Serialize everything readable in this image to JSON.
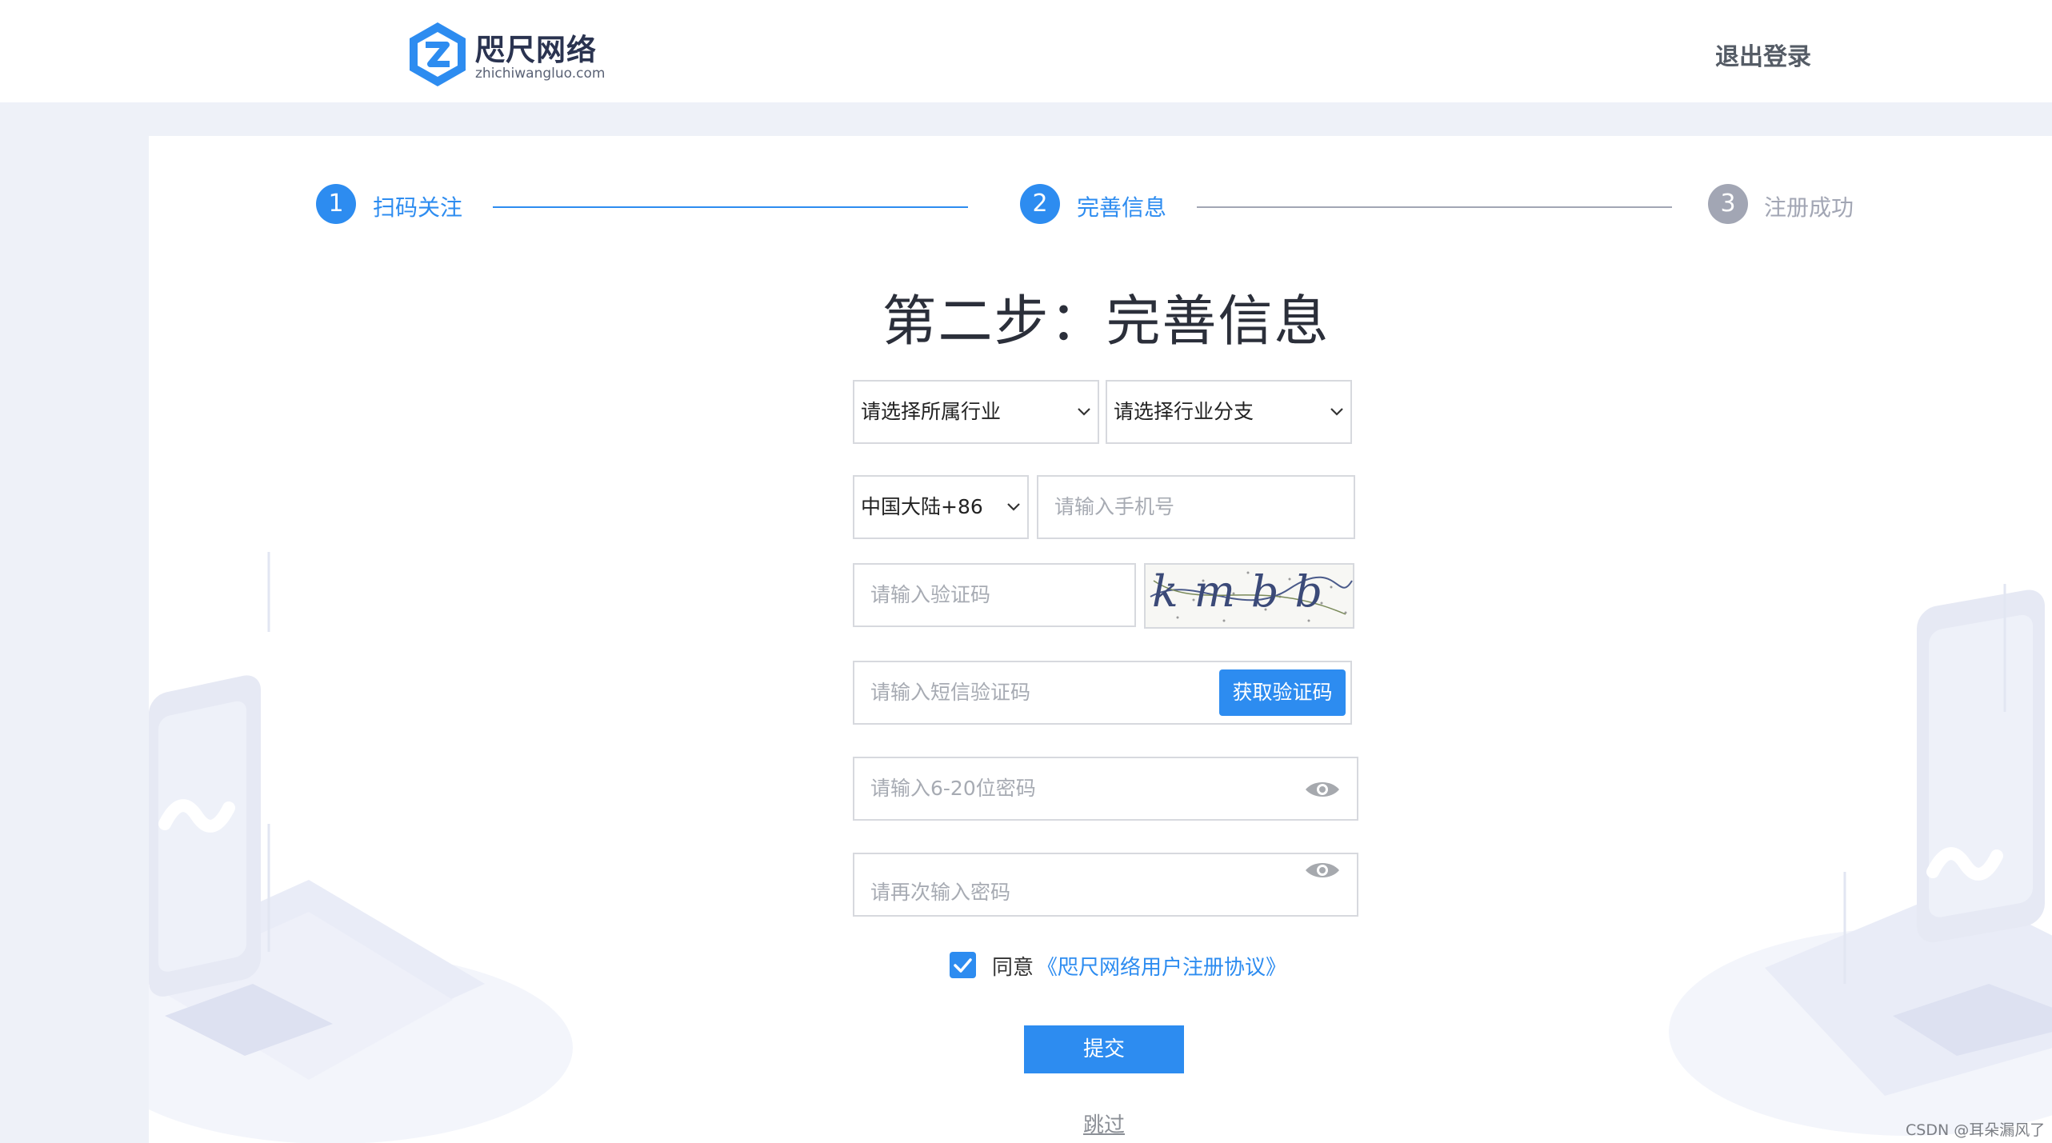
{
  "header": {
    "logo_name": "咫尺网络",
    "logo_sub": "zhichiwangluo.com",
    "logout_label": "退出登录"
  },
  "steps": [
    {
      "number": "1",
      "label": "扫码关注"
    },
    {
      "number": "2",
      "label": "完善信息"
    },
    {
      "number": "3",
      "label": "注册成功"
    }
  ],
  "colors": {
    "accent": "#2d8cf0",
    "inactive": "#a2a6b4",
    "background": "#eef1f8"
  },
  "form": {
    "title": "第二步：完善信息",
    "industry_select": "请选择所属行业",
    "branch_select": "请选择行业分支",
    "region_select": "中国大陆+86",
    "phone_placeholder": "请输入手机号",
    "captcha_placeholder": "请输入验证码",
    "captcha_text": "kmbb",
    "sms_placeholder": "请输入短信验证码",
    "sms_button": "获取验证码",
    "password_placeholder": "请输入6-20位密码",
    "password_confirm_placeholder": "请再次输入密码",
    "agree_text": "同意",
    "agree_link": "《咫尺网络用户注册协议》",
    "agree_checked": true,
    "submit_label": "提交",
    "skip_label": "跳过"
  },
  "watermark": "CSDN @耳朵漏风了"
}
